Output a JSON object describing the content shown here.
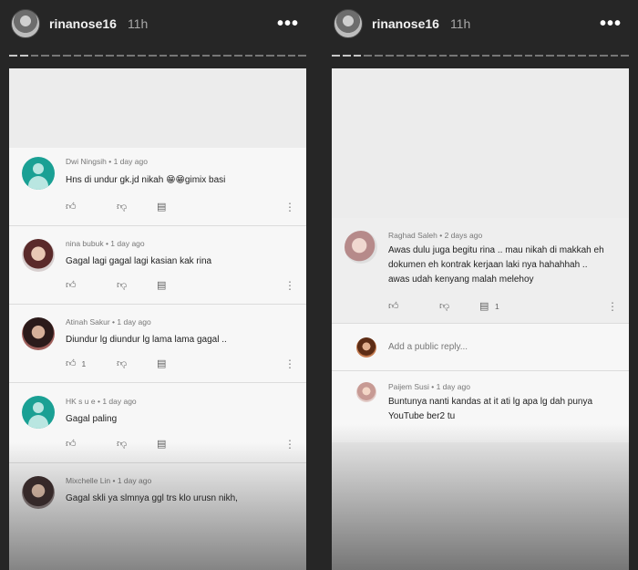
{
  "stories": [
    {
      "username": "rinanose16",
      "time": "11h",
      "comments": [
        {
          "author": "Dwi Ningsih",
          "age": "1 day ago",
          "text": "Hns di undur gk.jd nikah 😁😁gimix  basi",
          "likes": ""
        },
        {
          "author": "nina bubuk",
          "age": "1 day ago",
          "text": "Gagal lagi gagal lagi kasian kak rina",
          "likes": ""
        },
        {
          "author": "Atinah Sakur",
          "age": "1 day ago",
          "text": "Diundur lg diundur lg lama lama gagal ..",
          "likes": "1"
        },
        {
          "author": "HK s u e",
          "age": "1 day ago",
          "text": "Gagal paling",
          "likes": ""
        },
        {
          "author": "Mixchelle Lin",
          "age": "1 day ago",
          "text": "Gagal skli ya slmnya ggl trs klo urusn nikh,",
          "likes": ""
        }
      ]
    },
    {
      "username": "rinanose16",
      "time": "11h",
      "top_comment": {
        "author": "Raghad Saleh",
        "age": "2 days ago",
        "text_lines": [
          "Awas dulu juga begitu  rina .. mau nikah di makkah eh",
          "dokumen eh kontrak kerjaan laki nya hahahhah  ..",
          "awas udah kenyang  malah melehoy"
        ],
        "reply_count": "1"
      },
      "add_reply_placeholder": "Add a public reply...",
      "reply": {
        "author": "Paijem Susi",
        "age": "1 day ago",
        "text_lines": [
          "Buntunya nanti kandas at it ati lg apa lg dah punya",
          "YouTube ber2 tu"
        ]
      }
    }
  ],
  "icons": {
    "like": "thumbs-up-icon",
    "dislike": "thumbs-down-icon",
    "reply": "comment-icon",
    "more": "more-vertical-icon"
  }
}
